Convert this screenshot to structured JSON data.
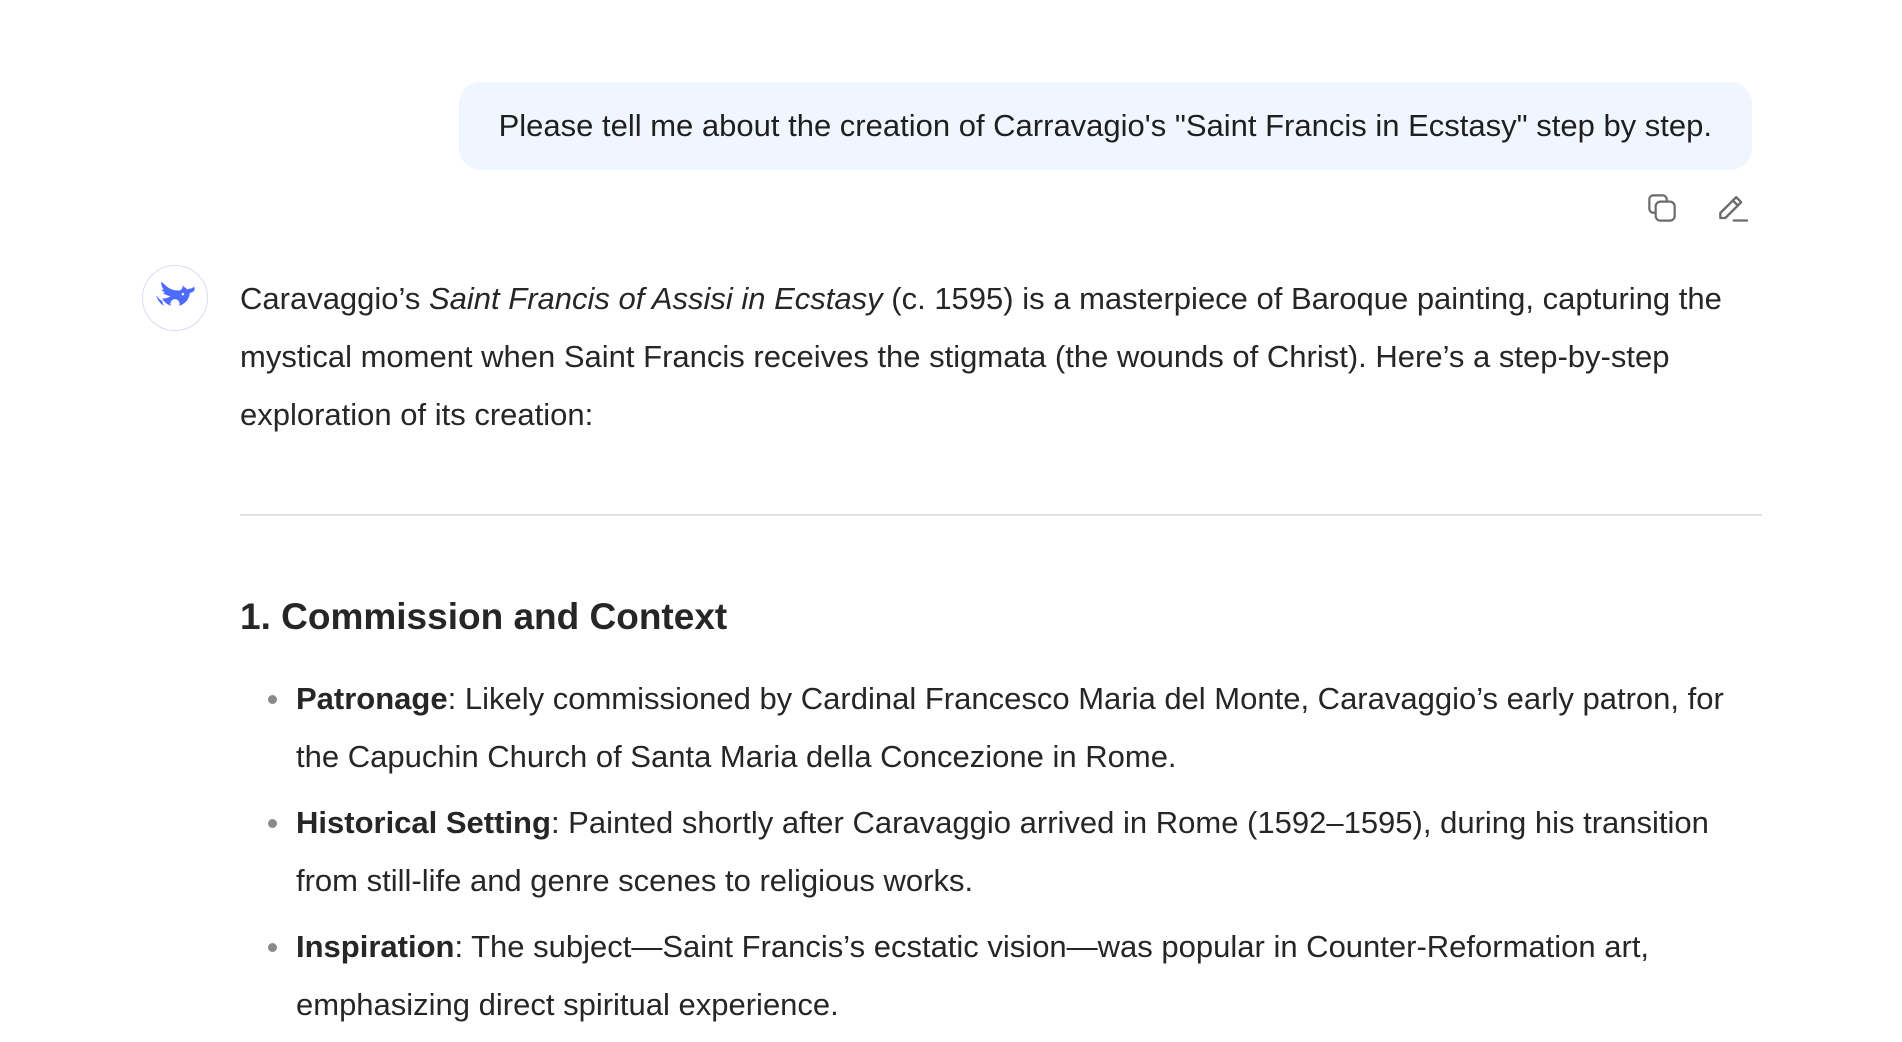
{
  "user_message": {
    "text": "Please tell me about the creation of Carravagio's \"Saint Francis in Ecstasy\" step by step."
  },
  "user_actions": {
    "copy_icon": "copy-icon",
    "edit_icon": "edit-icon"
  },
  "assistant": {
    "avatar_icon": "whale-logo-icon",
    "brand_color": "#4d6bfe",
    "intro": {
      "part1": "Caravaggio’s ",
      "title_italic": "Saint Francis of Assisi in Ecstasy",
      "part2": " (c. 1595) is a masterpiece of Baroque painting, capturing the mystical moment when Saint Francis receives the stigmata (the wounds of Christ). Here’s a step-by-step exploration of its creation:"
    },
    "section1": {
      "heading": "1. Commission and Context",
      "items": [
        {
          "label": "Patronage",
          "text": ": Likely commissioned by Cardinal Francesco Maria del Monte, Caravaggio’s early patron, for the Capuchin Church of Santa Maria della Concezione in Rome."
        },
        {
          "label": "Historical Setting",
          "text": ": Painted shortly after Caravaggio arrived in Rome (1592–1595), during his transition from still-life and genre scenes to religious works."
        },
        {
          "label": "Inspiration",
          "text": ": The subject—Saint Francis’s ecstatic vision—was popular in Counter-Reformation art, emphasizing direct spiritual experience."
        }
      ]
    }
  }
}
